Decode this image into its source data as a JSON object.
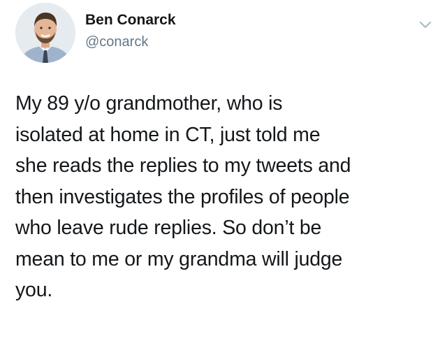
{
  "tweet": {
    "author": {
      "display_name": "Ben Conarck",
      "handle": "@conarck",
      "avatar_icon": "profile-photo"
    },
    "menu_icon": "chevron-down-icon",
    "text_lines": [
      "My 89 y/o grandmother, who is",
      "isolated at home in CT, just told me",
      "she reads the replies to my tweets and",
      "then investigates the profiles of people",
      "who leave rude replies. So don’t be",
      "mean to me or my grandma will judge",
      "you."
    ]
  },
  "colors": {
    "text_primary": "#14171a",
    "text_secondary": "#657786",
    "background": "#ffffff",
    "caret": "#aab8c2"
  }
}
